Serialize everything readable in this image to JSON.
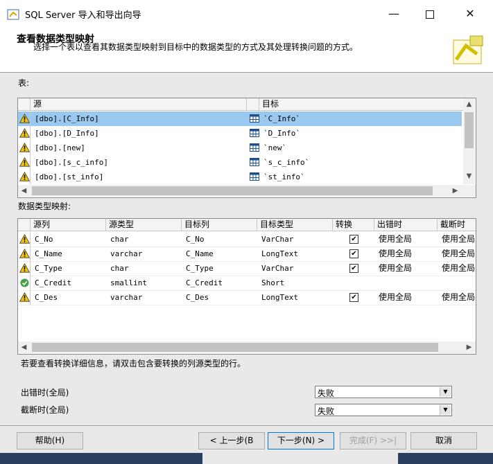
{
  "window": {
    "title": "SQL Server 导入和导出向导"
  },
  "header": {
    "title": "查看数据类型映射",
    "description": "选择一个表以查看其数据类型映射到目标中的数据类型的方式及其处理转换问题的方式。"
  },
  "tables_section": {
    "label": "表:",
    "columns": [
      "源",
      "目标"
    ],
    "rows": [
      {
        "source": "[dbo].[C_Info]",
        "target": "`C_Info`",
        "selected": true
      },
      {
        "source": "[dbo].[D_Info]",
        "target": "`D_Info`",
        "selected": false
      },
      {
        "source": "[dbo].[new]",
        "target": "`new`",
        "selected": false
      },
      {
        "source": "[dbo].[s_c_info]",
        "target": "`s_c_info`",
        "selected": false
      },
      {
        "source": "[dbo].[st_info]",
        "target": "`st_info`",
        "selected": false
      }
    ]
  },
  "mapping_section": {
    "label": "数据类型映射:",
    "columns": [
      "源列",
      "源类型",
      "目标列",
      "目标类型",
      "转换",
      "出错时",
      "截断时"
    ],
    "rows": [
      {
        "status": "warning",
        "source_col": "C_No",
        "source_type": "char",
        "target_col": "C_No",
        "target_type": "VarChar",
        "convert": true,
        "on_error": "使用全局",
        "on_truncate": "使用全局"
      },
      {
        "status": "warning",
        "source_col": "C_Name",
        "source_type": "varchar",
        "target_col": "C_Name",
        "target_type": "LongText",
        "convert": true,
        "on_error": "使用全局",
        "on_truncate": "使用全局"
      },
      {
        "status": "warning",
        "source_col": "C_Type",
        "source_type": "char",
        "target_col": "C_Type",
        "target_type": "VarChar",
        "convert": true,
        "on_error": "使用全局",
        "on_truncate": "使用全局"
      },
      {
        "status": "ok",
        "source_col": "C_Credit",
        "source_type": "smallint",
        "target_col": "C_Credit",
        "target_type": "Short",
        "convert": false,
        "on_error": "",
        "on_truncate": ""
      },
      {
        "status": "warning",
        "source_col": "C_Des",
        "source_type": "varchar",
        "target_col": "C_Des",
        "target_type": "LongText",
        "convert": true,
        "on_error": "使用全局",
        "on_truncate": "使用全局"
      }
    ]
  },
  "hint": "若要查看转换详细信息，请双击包含要转换的列源类型的行。",
  "global_options": {
    "on_error_label": "出错时(全局)",
    "on_error_value": "失败",
    "on_truncate_label": "截断时(全局)",
    "on_truncate_value": "失败"
  },
  "buttons": {
    "help": "帮助(H)",
    "back": "< 上一步(B",
    "next": "下一步(N) >",
    "finish": "完成(F) >>|",
    "cancel": "取消"
  },
  "colors": {
    "selection": "#99c9ef",
    "accent": "#0078d7",
    "warning": "#f5c400"
  }
}
